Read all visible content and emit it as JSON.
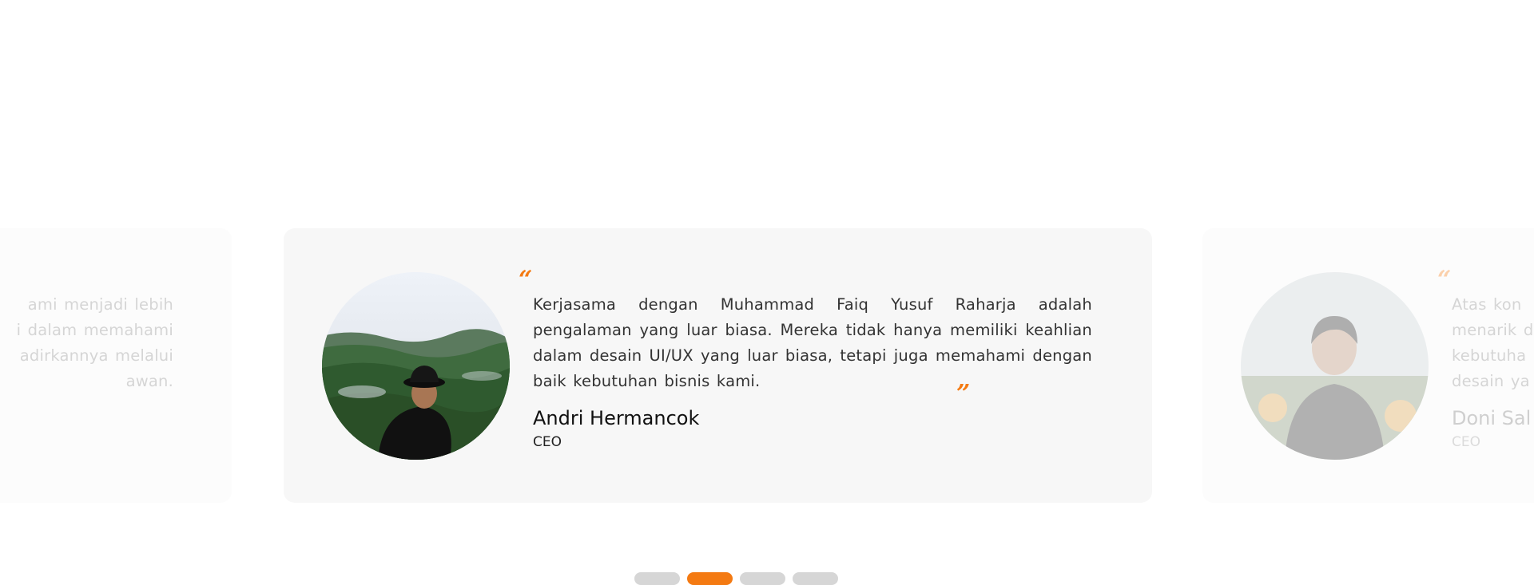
{
  "testimonials": [
    {
      "quote": "...kami menjadi lebih ... dalam memahami ... hadirkannya melalui ... karyawan.",
      "quote_lines": [
        "ami menjadi lebih",
        "i dalam memahami",
        "adirkannya melalui",
        "awan."
      ],
      "name": "",
      "role": ""
    },
    {
      "quote": "Kerjasama dengan Muhammad Faiq Yusuf Raharja adalah pengalaman yang luar biasa. Mereka tidak hanya memiliki keahlian dalam desain UI/UX yang luar biasa, tetapi juga memahami dengan baik kebutuhan bisnis kami.",
      "name": "Andri Hermancok",
      "role": "CEO",
      "open_quote": "“",
      "close_quote": "”"
    },
    {
      "quote_lines": [
        "Atas kon",
        "menarik d",
        "kebutuha",
        "desain ya"
      ],
      "name": "Doni Sal",
      "role": "CEO",
      "open_quote": "“"
    }
  ],
  "pagination": {
    "count": 4,
    "active_index": 1
  },
  "colors": {
    "accent": "#f47a12",
    "card_bg": "#f7f7f7",
    "dot_inactive": "#d6d6d6"
  }
}
